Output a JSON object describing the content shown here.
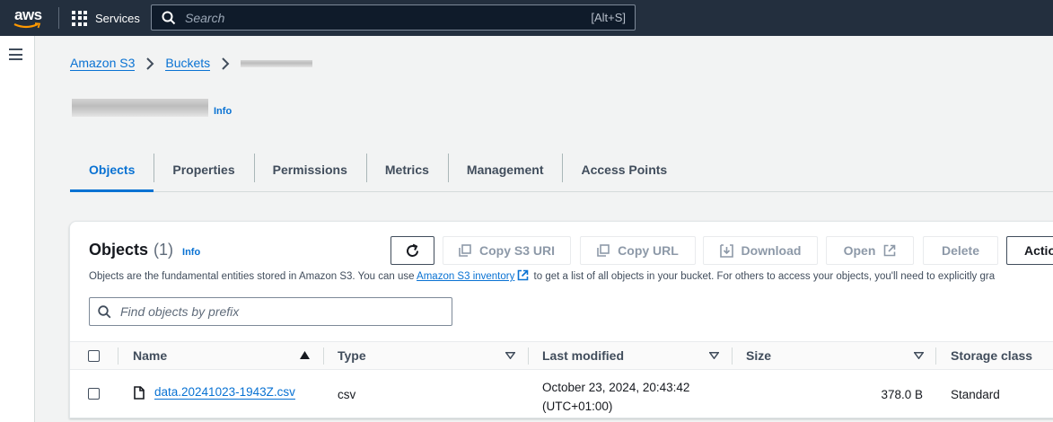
{
  "topnav": {
    "logo_text": "aws",
    "services_label": "Services",
    "search_placeholder": "Search",
    "search_shortcut": "[Alt+S]"
  },
  "breadcrumb": {
    "items": [
      "Amazon S3",
      "Buckets"
    ]
  },
  "page": {
    "info_label": "Info"
  },
  "tabs": [
    {
      "label": "Objects",
      "active": true
    },
    {
      "label": "Properties",
      "active": false
    },
    {
      "label": "Permissions",
      "active": false
    },
    {
      "label": "Metrics",
      "active": false
    },
    {
      "label": "Management",
      "active": false
    },
    {
      "label": "Access Points",
      "active": false
    }
  ],
  "objects_panel": {
    "title": "Objects",
    "count": "(1)",
    "info_label": "Info",
    "description_before": "Objects are the fundamental entities stored in Amazon S3. You can use ",
    "description_link": "Amazon S3 inventory",
    "description_after": " to get a list of all objects in your bucket. For others to access your objects, you'll need to explicitly gra",
    "buttons": {
      "copy_s3_uri": "Copy S3 URI",
      "copy_url": "Copy URL",
      "download": "Download",
      "open": "Open",
      "delete": "Delete",
      "actions": "Actio"
    },
    "find_placeholder": "Find objects by prefix",
    "columns": {
      "name": "Name",
      "type": "Type",
      "last_modified": "Last modified",
      "size": "Size",
      "storage_class": "Storage class"
    },
    "rows": [
      {
        "name": "data.20241023-1943Z.csv",
        "type": "csv",
        "last_modified_line1": "October 23, 2024, 20:43:42",
        "last_modified_line2": "(UTC+01:00)",
        "size": "378.0 B",
        "storage_class": "Standard"
      }
    ]
  },
  "colors": {
    "nav_bg": "#232f3e",
    "link": "#0972d3",
    "text": "#16191f",
    "page_bg": "#f2f3f3"
  },
  "icons": [
    "aws-logo-smile",
    "services-grid-icon",
    "search-icon",
    "menu-icon",
    "chevron-right-icon",
    "refresh-icon",
    "copy-icon",
    "download-icon",
    "external-link-icon",
    "sort-ascending-icon",
    "sort-descending-icon",
    "file-icon"
  ]
}
